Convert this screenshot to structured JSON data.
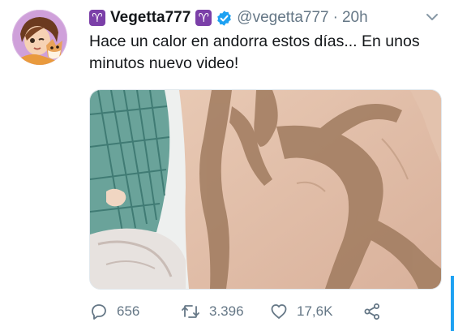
{
  "author": {
    "badge_glyph": "♈",
    "display_name": "Vegetta777",
    "handle": "@vegetta777",
    "time": "20h",
    "separator": "·"
  },
  "tweet": {
    "text": "Hace un calor en andorra estos días... En unos minutos nuevo video!"
  },
  "stats": {
    "replies": "656",
    "retweets": "3.396",
    "likes": "17,6K"
  },
  "icons": {
    "reply": "reply-icon",
    "retweet": "retweet-icon",
    "like": "heart-icon",
    "share": "share-icon",
    "verified": "verified-badge-icon",
    "caret": "chevron-down-icon"
  },
  "colors": {
    "verified": "#1da1f2",
    "badge": "#7b3fa8",
    "muted": "#657786",
    "text": "#14171a"
  }
}
